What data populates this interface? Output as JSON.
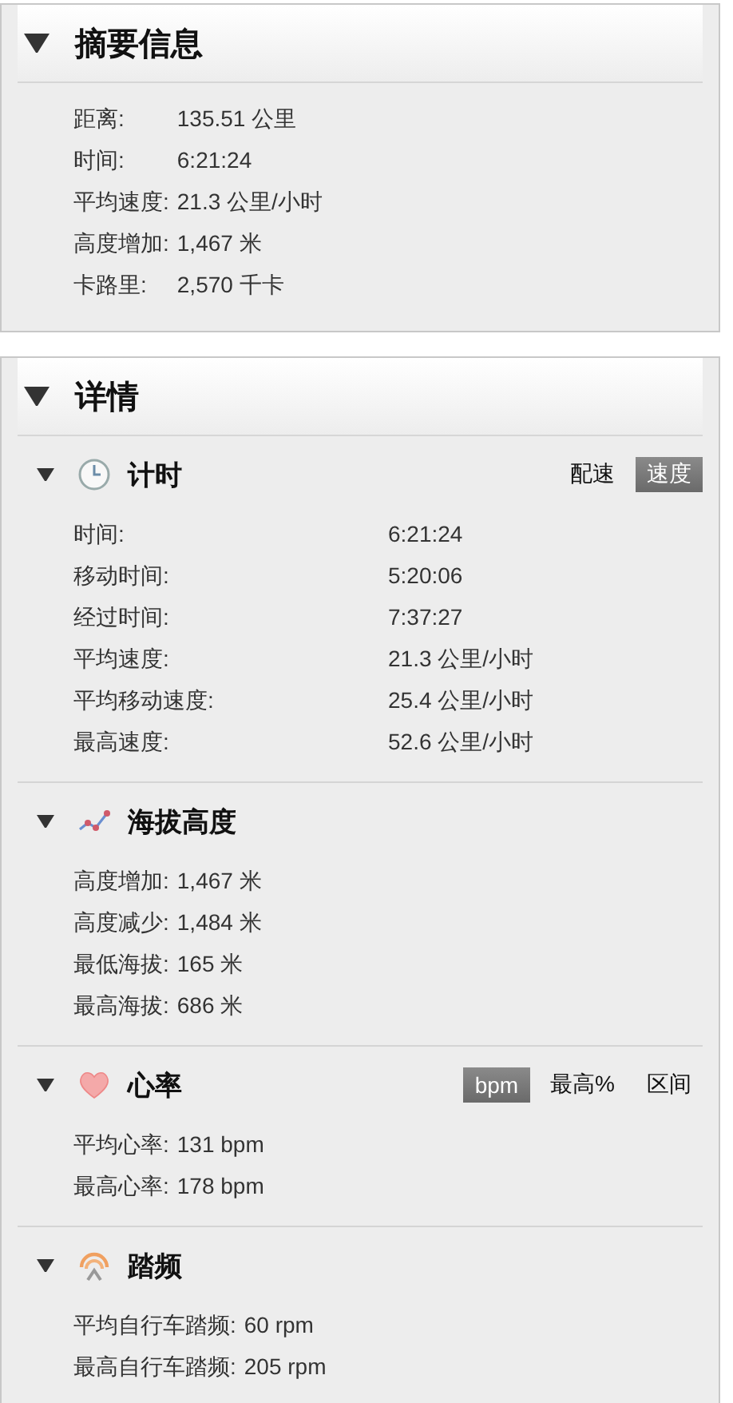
{
  "summary": {
    "title": "摘要信息",
    "expanded": true,
    "rows": [
      {
        "label": "距离:",
        "value": "135.51 公里"
      },
      {
        "label": "时间:",
        "value": "6:21:24"
      },
      {
        "label": "平均速度:",
        "value": "21.3 公里/小时"
      },
      {
        "label": "高度增加:",
        "value": "1,467 米"
      },
      {
        "label": "卡路里:",
        "value": "2,570 千卡"
      }
    ]
  },
  "details": {
    "title": "详情",
    "expanded": true,
    "sections": [
      {
        "kind": "timer",
        "title": "计时",
        "expanded": true,
        "toggles": [
          {
            "label": "配速",
            "selected": false
          },
          {
            "label": "速度",
            "selected": true
          }
        ],
        "rows": [
          {
            "label": "时间:",
            "value": "6:21:24"
          },
          {
            "label": "移动时间:",
            "value": "5:20:06"
          },
          {
            "label": "经过时间:",
            "value": "7:37:27"
          },
          {
            "label": "平均速度:",
            "value": "21.3 公里/小时"
          },
          {
            "label": "平均移动速度:",
            "value": "25.4 公里/小时"
          },
          {
            "label": "最高速度:",
            "value": "52.6 公里/小时"
          }
        ]
      },
      {
        "kind": "elevation",
        "title": "海拔高度",
        "expanded": true,
        "rows": [
          {
            "label": "高度增加:",
            "value": "1,467 米"
          },
          {
            "label": "高度减少:",
            "value": "1,484 米"
          },
          {
            "label": "最低海拔:",
            "value": "165 米"
          },
          {
            "label": "最高海拔:",
            "value": "686 米"
          }
        ]
      },
      {
        "kind": "heart_rate",
        "title": "心率",
        "expanded": true,
        "toggles": [
          {
            "label": "bpm",
            "selected": true
          },
          {
            "label": "最高%",
            "selected": false
          },
          {
            "label": "区间",
            "selected": false
          }
        ],
        "rows": [
          {
            "label": "平均心率:",
            "value": "131 bpm"
          },
          {
            "label": "最高心率:",
            "value": "178 bpm"
          }
        ]
      },
      {
        "kind": "cadence",
        "title": "踏频",
        "expanded": true,
        "rows": [
          {
            "label": "平均自行车踏频:",
            "value": "60 rpm"
          },
          {
            "label": "最高自行车踏频:",
            "value": "205 rpm"
          }
        ]
      }
    ]
  }
}
